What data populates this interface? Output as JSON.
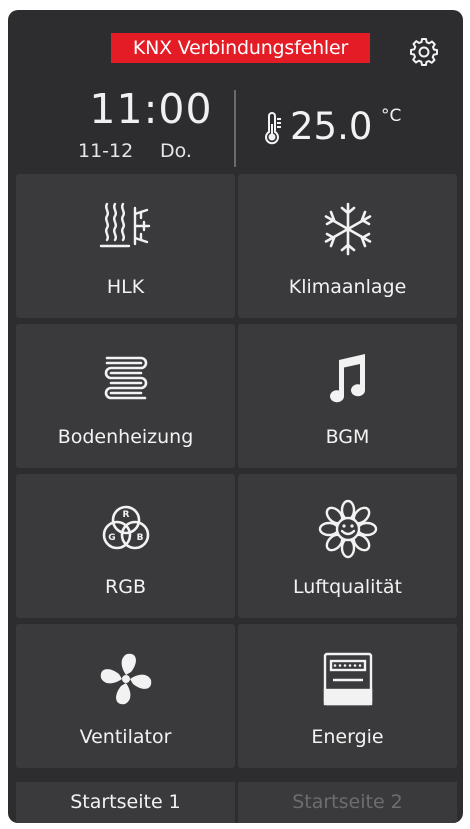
{
  "header": {
    "error_message": "KNX Verbindungsfehler",
    "error_color": "#e31c25",
    "settings_icon": "gear-icon"
  },
  "clock": {
    "time": "11:00",
    "date": "11-12",
    "weekday": "Do."
  },
  "temperature": {
    "icon": "thermometer-icon",
    "value": "25.0",
    "unit": "°C"
  },
  "tiles": [
    {
      "label": "HLK",
      "icon": "hvac-icon"
    },
    {
      "label": "Klimaanlage",
      "icon": "snowflake-icon"
    },
    {
      "label": "Bodenheizung",
      "icon": "floor-heating-icon"
    },
    {
      "label": "BGM",
      "icon": "music-note-icon"
    },
    {
      "label": "RGB",
      "icon": "rgb-icon"
    },
    {
      "label": "Luftqualität",
      "icon": "flower-smile-icon"
    },
    {
      "label": "Ventilator",
      "icon": "fan-icon"
    },
    {
      "label": "Energie",
      "icon": "energy-meter-icon"
    }
  ],
  "pages": [
    {
      "label": "Startseite 1",
      "active": true
    },
    {
      "label": "Startseite 2",
      "active": false
    }
  ]
}
